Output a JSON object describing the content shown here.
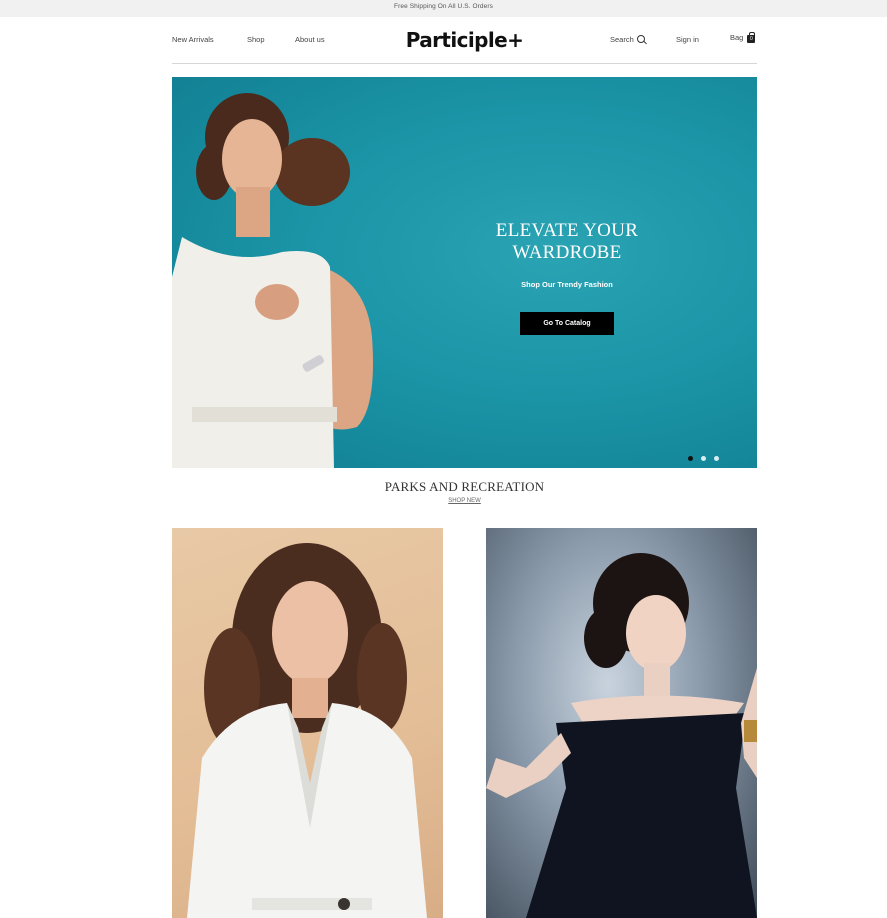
{
  "announcement": "Free Shipping On All U.S. Orders",
  "nav": {
    "left": [
      "New Arrivals",
      "Shop",
      "About us"
    ],
    "brand": "Participle+",
    "search_label": "Search",
    "signin_label": "Sign in",
    "bag_label": "Bag",
    "bag_count": "0"
  },
  "hero": {
    "title_line1": "ELEVATE YOUR",
    "title_line2": "WARDROBE",
    "subtitle": "Shop Our Trendy Fashion",
    "cta_label": "Go To Catalog",
    "slide_count": 3,
    "active_slide": 1,
    "background_color": "#1b95a7"
  },
  "section": {
    "title": "PARKS AND RECREATION",
    "link": "SHOP NEW"
  },
  "colors": {
    "accent": "#000000",
    "topbar": "#f1f1f1"
  }
}
